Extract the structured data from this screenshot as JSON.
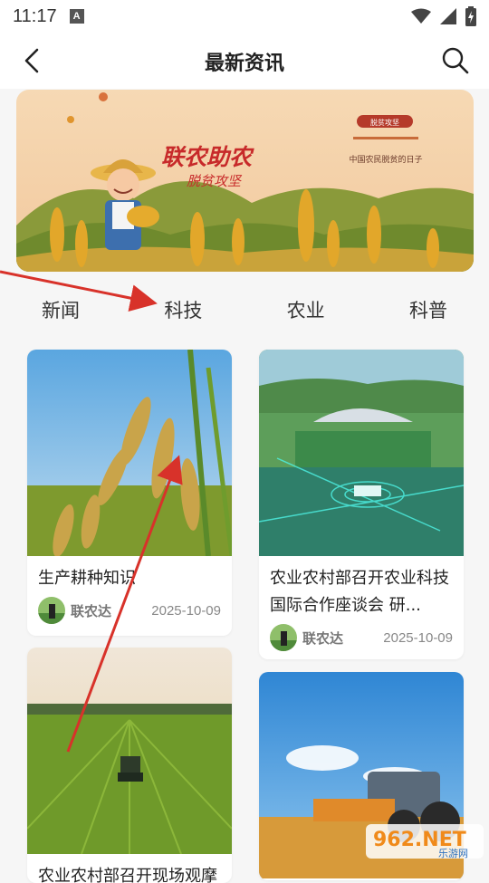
{
  "status_bar": {
    "time": "11:17",
    "notification_badge": "A"
  },
  "header": {
    "title": "最新资讯"
  },
  "banner": {
    "title": "联农助农",
    "subtitle": "脱贫攻坚",
    "small_tag": "脱贫攻坚",
    "caption": "中国农民脱贫的日子"
  },
  "tabs": [
    {
      "label": "新闻"
    },
    {
      "label": "科技"
    },
    {
      "label": "农业"
    },
    {
      "label": "科普"
    }
  ],
  "articles": [
    {
      "title": "生产耕种知识",
      "author": "联农达",
      "date": "2025-10-09"
    },
    {
      "title": "农业农村部召开农业科技国际合作座谈会 研...",
      "author": "联农达",
      "date": "2025-10-09"
    },
    {
      "title": "农业农村部召开现场观摩",
      "author": "",
      "date": ""
    },
    {
      "title": "",
      "author": "",
      "date": ""
    }
  ],
  "watermark": {
    "text": "962.NET",
    "subtext": "乐游网"
  }
}
